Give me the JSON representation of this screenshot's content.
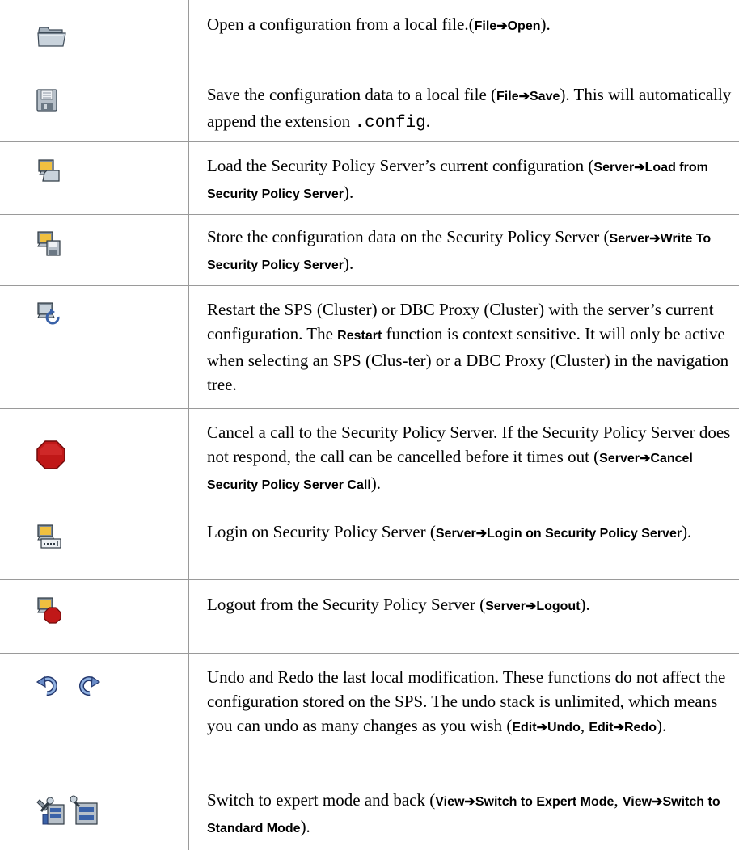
{
  "rows": [
    {
      "pre": "Open a configuration from a local file.(",
      "cmd": "File➔Open",
      "post": ")."
    },
    {
      "pre": "Save the configuration data to a local file (",
      "cmd": "File➔Save",
      "mid": "). This will automatically append the extension ",
      "ext": ".config",
      "post": "."
    },
    {
      "pre": "Load the Security Policy Server’s current configuration (",
      "cmd": "Server➔Load from Security Policy Server",
      "post": ")."
    },
    {
      "pre": "Store the configuration data on the Security Policy Server (",
      "cmd": "Server➔Write To Security Policy Server",
      "post": ")."
    },
    {
      "pre": "Restart the SPS (Cluster) or DBC Proxy (Cluster) with the server’s current configuration. The ",
      "cmd": "Restart",
      "post": " function is context sensitive. It will only be active when selecting an SPS (Clus-ter) or a DBC Proxy (Cluster) in the navigation tree."
    },
    {
      "pre": "Cancel a call to the Security Policy Server. If the Security Policy Server does not respond, the call can be cancelled before it times out (",
      "cmd": "Server➔Cancel Security Policy Server Call",
      "post": ")."
    },
    {
      "pre": "Login on Security Policy Server (",
      "cmd": "Server➔Login on Security Policy Server",
      "post": ")."
    },
    {
      "pre": "Logout from the Security Policy Server (",
      "cmd": "Server➔Logout",
      "post": ")."
    },
    {
      "pre": "Undo and Redo the last local modification. These functions do not affect the configuration stored on the SPS. The undo stack is unlimited, which means you can undo as many changes as you wish (",
      "cmd": "Edit➔Undo",
      "mid": ", ",
      "cmd2": "Edit➔Redo",
      "post": ")."
    },
    {
      "pre": "Switch to expert mode and back (",
      "cmd": "View➔Switch to Expert Mode",
      "mid": ", ",
      "cmd2": "View➔Switch to Standard Mode",
      "post": ")."
    }
  ]
}
